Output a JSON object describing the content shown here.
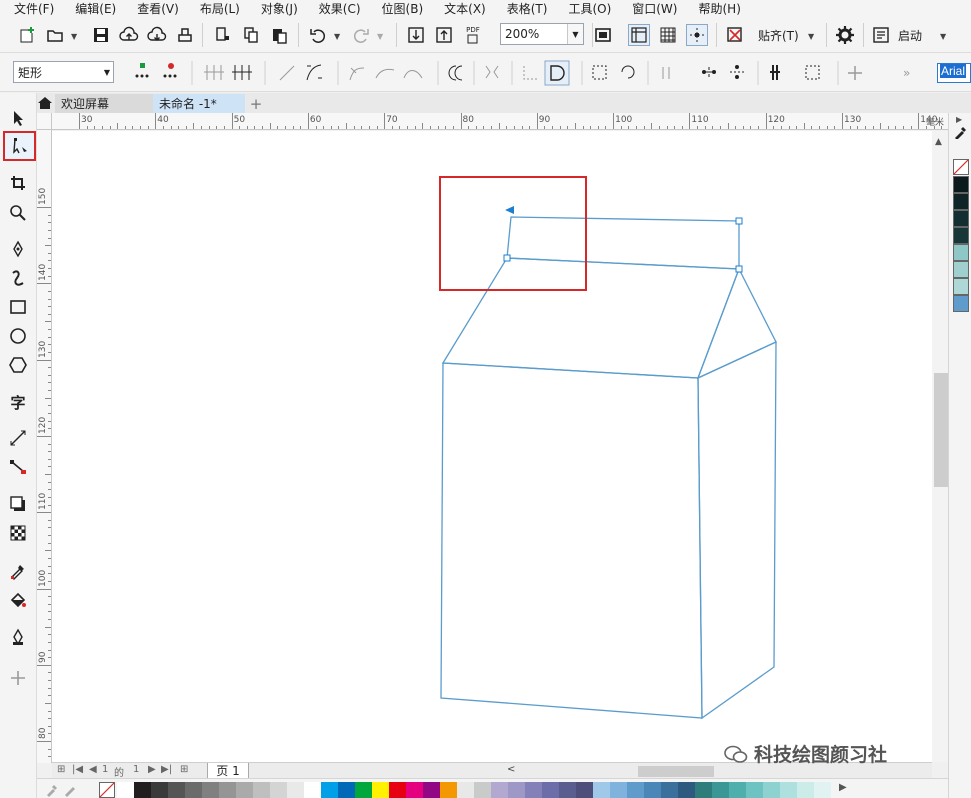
{
  "menu": [
    "文件(F)",
    "编辑(E)",
    "查看(V)",
    "布局(L)",
    "对象(J)",
    "效果(C)",
    "位图(B)",
    "文本(X)",
    "表格(T)",
    "工具(O)",
    "窗口(W)",
    "帮助(H)"
  ],
  "toolbar": {
    "zoom_value": "200%",
    "snap_label": "贴齐(T)",
    "launch_label": "启动",
    "pdf_label": "PDF"
  },
  "property_bar": {
    "shape_type": "矩形",
    "font_name": "Arial"
  },
  "tabs": {
    "welcome": "欢迎屏幕",
    "document": "未命名 -1*"
  },
  "ruler": {
    "top_labels": [
      "30",
      "40",
      "50",
      "60",
      "70",
      "80",
      "90",
      "100",
      "110",
      "120",
      "130",
      "140"
    ],
    "top_unit": "毫米",
    "left_labels": [
      "150",
      "140",
      "130",
      "120",
      "110",
      "100",
      "90",
      "80"
    ]
  },
  "page_nav": {
    "current": "1",
    "of_label": "的",
    "total": "1",
    "page_tab": "页 1"
  },
  "watermark": "科技绘图颜习社",
  "colors": {
    "outline": "#5a9ccc",
    "node": "#1e7fd0",
    "highlight_box": "#d62828",
    "palette_h": [
      "#ffffff",
      "#221e1f",
      "#3a3a3a",
      "#555555",
      "#6b6b6b",
      "#808080",
      "#959595",
      "#aaaaaa",
      "#bfbfbf",
      "#d4d4d4",
      "#e9e9e9",
      "#ffffff",
      "#00a0e9",
      "#0068b7",
      "#00a73c",
      "#fff100",
      "#e60012",
      "#e4007f",
      "#920783",
      "#f39800",
      "#e8e8e8",
      "#c9caca",
      "#b3a8cf",
      "#9e98c6",
      "#8481b9",
      "#6b6ea8",
      "#5a5e8f",
      "#4d4f7a",
      "#a0c8e8",
      "#7fb3dd",
      "#5f9ccc",
      "#4b86b9",
      "#3b6f9c",
      "#2f5a80",
      "#2e7d7a",
      "#3a9795",
      "#4eafad",
      "#6cc3c1",
      "#8dd2d0",
      "#aee0df",
      "#ccecea",
      "#e0f3f2"
    ],
    "palette_v": [
      "#0b1a1c",
      "#0f2426",
      "#132e30",
      "#173638",
      "#8fc7c6",
      "#9fcfce",
      "#aed8d6",
      "#5f9ccc"
    ]
  }
}
